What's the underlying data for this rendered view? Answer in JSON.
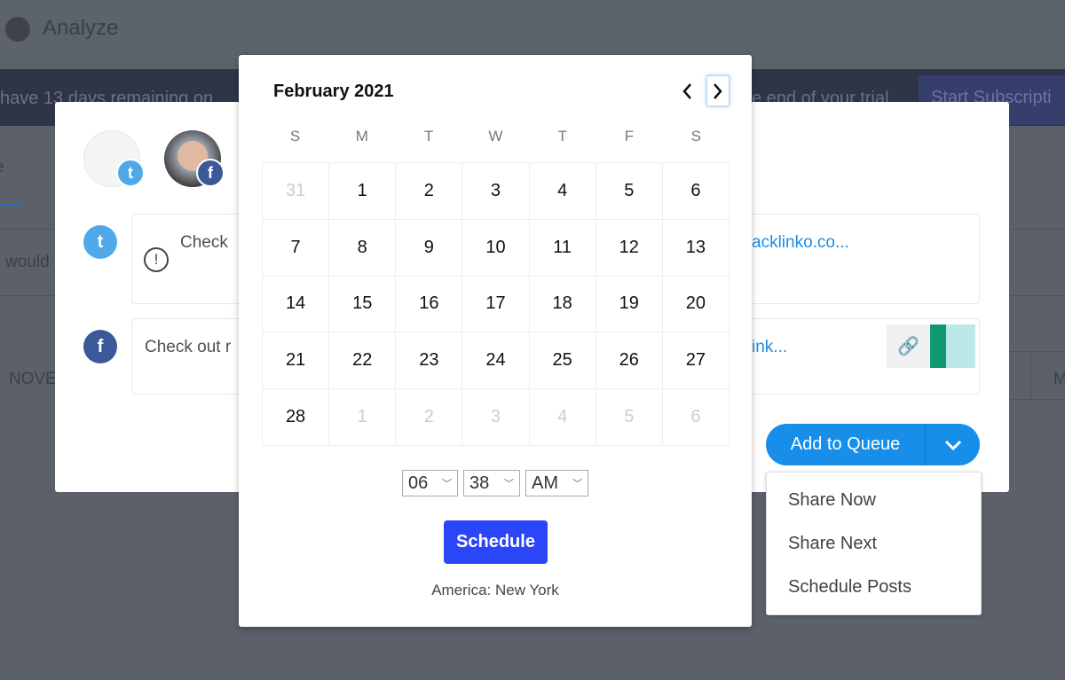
{
  "header": {
    "title": "Analyze",
    "icon": "pie-chart-icon"
  },
  "banner": {
    "text_left": "have 13 days remaining on",
    "text_right": "e end of your trial",
    "button": "Start Subscripti"
  },
  "background": {
    "tab_fragment": "e",
    "row_fragment": "would",
    "column_fragment": "NOVE",
    "column_fragment_right": "M"
  },
  "composer": {
    "posts": [
      {
        "network": "twitter",
        "text": "Check",
        "link": "acklinko.co..."
      },
      {
        "network": "facebook",
        "text": "Check out r",
        "link": "ink..."
      }
    ],
    "add_to_queue": "Add to Queue",
    "menu": [
      "Share Now",
      "Share Next",
      "Schedule Posts"
    ],
    "colors": {
      "primary": "#168eea",
      "twitter": "#4fa8ea",
      "facebook": "#3b5998"
    }
  },
  "calendar": {
    "title": "February 2021",
    "weekdays": [
      "S",
      "M",
      "T",
      "W",
      "T",
      "F",
      "S"
    ],
    "days": [
      "31",
      "1",
      "2",
      "3",
      "4",
      "5",
      "6",
      "7",
      "8",
      "9",
      "10",
      "11",
      "12",
      "13",
      "14",
      "15",
      "16",
      "17",
      "18",
      "19",
      "20",
      "21",
      "22",
      "23",
      "24",
      "25",
      "26",
      "27",
      "28",
      "1",
      "2",
      "3",
      "4",
      "5",
      "6"
    ],
    "hour": "06",
    "minute": "38",
    "ampm": "AM",
    "schedule": "Schedule",
    "timezone": "America: New York",
    "accent": "#2b45f8"
  }
}
